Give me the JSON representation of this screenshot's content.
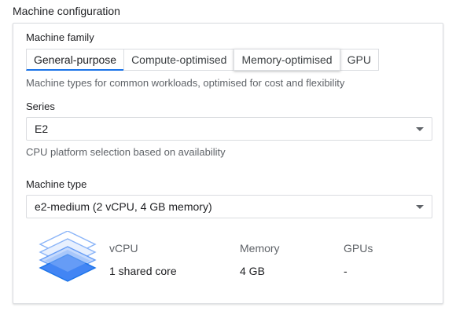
{
  "section": {
    "title": "Machine configuration"
  },
  "family": {
    "label": "Machine family",
    "tabs": [
      {
        "label": "General-purpose",
        "selected": true
      },
      {
        "label": "Compute-optimised",
        "selected": false
      },
      {
        "label": "Memory-optimised",
        "selected": false
      },
      {
        "label": "GPU",
        "selected": false
      }
    ],
    "hint": "Machine types for common workloads, optimised for cost and flexibility"
  },
  "series": {
    "label": "Series",
    "value": "E2",
    "hint": "CPU platform selection based on availability"
  },
  "machine_type": {
    "label": "Machine type",
    "value": "e2-medium (2 vCPU, 4 GB memory)"
  },
  "specs": {
    "icon": "stacked-layers-icon",
    "columns": [
      {
        "header": "vCPU",
        "value": "1 shared core"
      },
      {
        "header": "Memory",
        "value": "4 GB"
      },
      {
        "header": "GPUs",
        "value": "-"
      }
    ]
  },
  "colors": {
    "accent": "#1a73e8",
    "icon_light": "#c6dafc",
    "icon_dark": "#4285f4",
    "border": "#dadce0"
  }
}
